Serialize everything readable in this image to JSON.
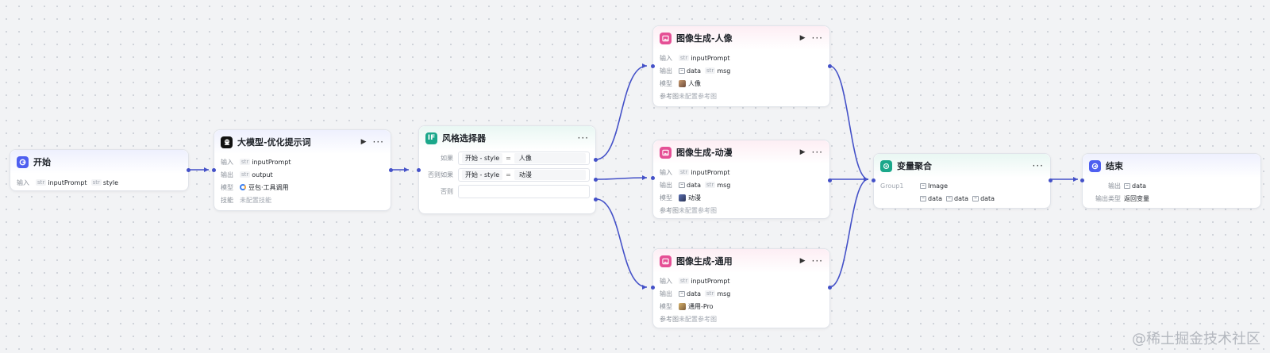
{
  "nodes": {
    "start": {
      "title": "开始",
      "input_label": "输入",
      "inputs": [
        {
          "type": "str",
          "name": "inputPrompt"
        },
        {
          "type": "str",
          "name": "style"
        }
      ]
    },
    "llm": {
      "title": "大模型-优化提示词",
      "input_label": "输入",
      "input": {
        "type": "str",
        "name": "inputPrompt"
      },
      "output_label": "输出",
      "output": {
        "type": "str",
        "name": "output"
      },
      "model_label": "模型",
      "model": "豆包·工具调用",
      "skill_label": "技能",
      "skill": "未配置技能"
    },
    "selector": {
      "title": "风格选择器",
      "icon": "IF",
      "conditions": [
        {
          "label": "如果",
          "left": "开始",
          "dash": "-",
          "field": "style",
          "op": "=",
          "value": "人像"
        },
        {
          "label": "否则如果",
          "left": "开始",
          "dash": "-",
          "field": "style",
          "op": "=",
          "value": "动漫"
        }
      ],
      "else_label": "否则"
    },
    "portrait": {
      "title": "图像生成-人像",
      "input_label": "输入",
      "input": {
        "type": "str",
        "name": "inputPrompt"
      },
      "output_label": "输出",
      "outputs": [
        {
          "type": "img",
          "name": "data"
        },
        {
          "type": "str",
          "name": "msg"
        }
      ],
      "model_label": "模型",
      "model": "人像",
      "ref_label": "参考图",
      "ref": "未配置参考图"
    },
    "anime": {
      "title": "图像生成-动漫",
      "input_label": "输入",
      "input": {
        "type": "str",
        "name": "inputPrompt"
      },
      "output_label": "输出",
      "outputs": [
        {
          "type": "img",
          "name": "data"
        },
        {
          "type": "str",
          "name": "msg"
        }
      ],
      "model_label": "模型",
      "model": "动漫",
      "ref_label": "参考图",
      "ref": "未配置参考图"
    },
    "general": {
      "title": "图像生成-通用",
      "input_label": "输入",
      "input": {
        "type": "str",
        "name": "inputPrompt"
      },
      "output_label": "输出",
      "outputs": [
        {
          "type": "img",
          "name": "data"
        },
        {
          "type": "str",
          "name": "msg"
        }
      ],
      "model_label": "模型",
      "model": "通用-Pro",
      "ref_label": "参考图",
      "ref": "未配置参考图"
    },
    "aggregate": {
      "title": "变量聚合",
      "group_label": "Group1",
      "group_type": "Image",
      "items": [
        "data",
        "data",
        "data"
      ]
    },
    "end": {
      "title": "结束",
      "output_label": "输出",
      "output": "data",
      "output_type_label": "输出类型",
      "output_type": "返回变量"
    }
  },
  "icons": {
    "start": "start-icon",
    "llm": "llm-icon",
    "selector": "if-icon",
    "image": "image-generation-icon",
    "aggregate": "aggregate-icon",
    "end": "end-icon",
    "run": "play-icon",
    "more": "more-icon"
  },
  "colors": {
    "edge": "#4451c8",
    "accent_blue": "#4e5ff0",
    "image_pink": "#e54f95",
    "aggregate_teal": "#1aa78a"
  },
  "labels": {
    "str": "str",
    "more": "···",
    "run": "▶"
  },
  "watermark": "@稀土掘金技术社区"
}
